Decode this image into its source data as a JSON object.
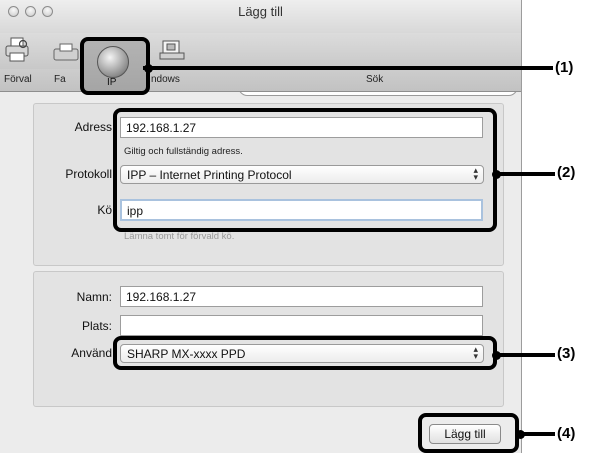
{
  "window": {
    "title": "Lägg till"
  },
  "toolbar": {
    "default_label": "Förval",
    "fax_label": "Fa",
    "ip_label": "IP",
    "windows_label": "ndows",
    "search_label": "Sök"
  },
  "form": {
    "address_label": "Adress",
    "address_value": "192.168.1.27",
    "address_hint": "Giltig och fullständig adress.",
    "protocol_label": "Protokoll",
    "protocol_value": "IPP – Internet Printing Protocol",
    "queue_label": "Kö",
    "queue_value": "ipp",
    "queue_hint": "Lämna tomt för förvald kö.",
    "name_label": "Namn:",
    "name_value": "192.168.1.27",
    "location_label": "Plats:",
    "location_value": "",
    "use_label": "Använd",
    "use_value": "SHARP MX-xxxx PPD"
  },
  "buttons": {
    "add_label": "Lägg till"
  },
  "callouts": {
    "c1": "(1)",
    "c2": "(2)",
    "c3": "(3)",
    "c4": "(4)"
  }
}
